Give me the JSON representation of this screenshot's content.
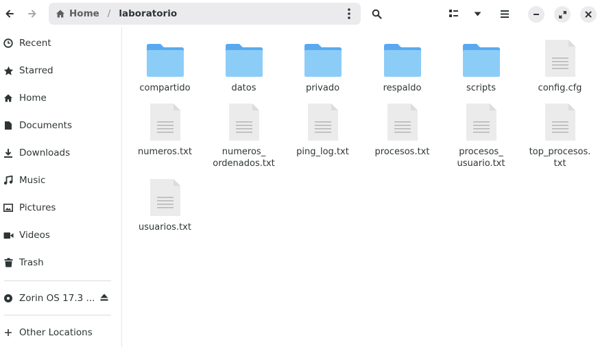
{
  "header": {
    "path_home": "Home",
    "path_separator": "/",
    "path_current": "laboratorio"
  },
  "sidebar": {
    "items": [
      {
        "label": "Recent",
        "icon": "clock-icon"
      },
      {
        "label": "Starred",
        "icon": "star-icon"
      },
      {
        "label": "Home",
        "icon": "home-icon"
      },
      {
        "label": "Documents",
        "icon": "document-icon"
      },
      {
        "label": "Downloads",
        "icon": "download-icon"
      },
      {
        "label": "Music",
        "icon": "music-icon"
      },
      {
        "label": "Pictures",
        "icon": "picture-icon"
      },
      {
        "label": "Videos",
        "icon": "video-icon"
      },
      {
        "label": "Trash",
        "icon": "trash-icon"
      }
    ],
    "devices": [
      {
        "label": "Zorin OS 17.3 ...",
        "icon": "disc-icon"
      }
    ],
    "other": {
      "label": "Other Locations",
      "icon": "plus-icon"
    }
  },
  "files": [
    {
      "name": "compartido",
      "type": "folder"
    },
    {
      "name": "datos",
      "type": "folder"
    },
    {
      "name": "privado",
      "type": "folder"
    },
    {
      "name": "respaldo",
      "type": "folder"
    },
    {
      "name": "scripts",
      "type": "folder"
    },
    {
      "name": "config.cfg",
      "type": "file"
    },
    {
      "name": "numeros.txt",
      "type": "file"
    },
    {
      "name": "numeros_\nordenados.txt",
      "type": "file"
    },
    {
      "name": "ping_log.txt",
      "type": "file"
    },
    {
      "name": "procesos.txt",
      "type": "file"
    },
    {
      "name": "procesos_\nusuario.txt",
      "type": "file"
    },
    {
      "name": "top_procesos.\ntxt",
      "type": "file"
    },
    {
      "name": "usuarios.txt",
      "type": "file"
    }
  ],
  "colors": {
    "folder_back": "#5aa9f0",
    "folder_front": "#8ccdf7",
    "file_bg": "#ebebeb",
    "file_lines": "#b4b4b4"
  }
}
